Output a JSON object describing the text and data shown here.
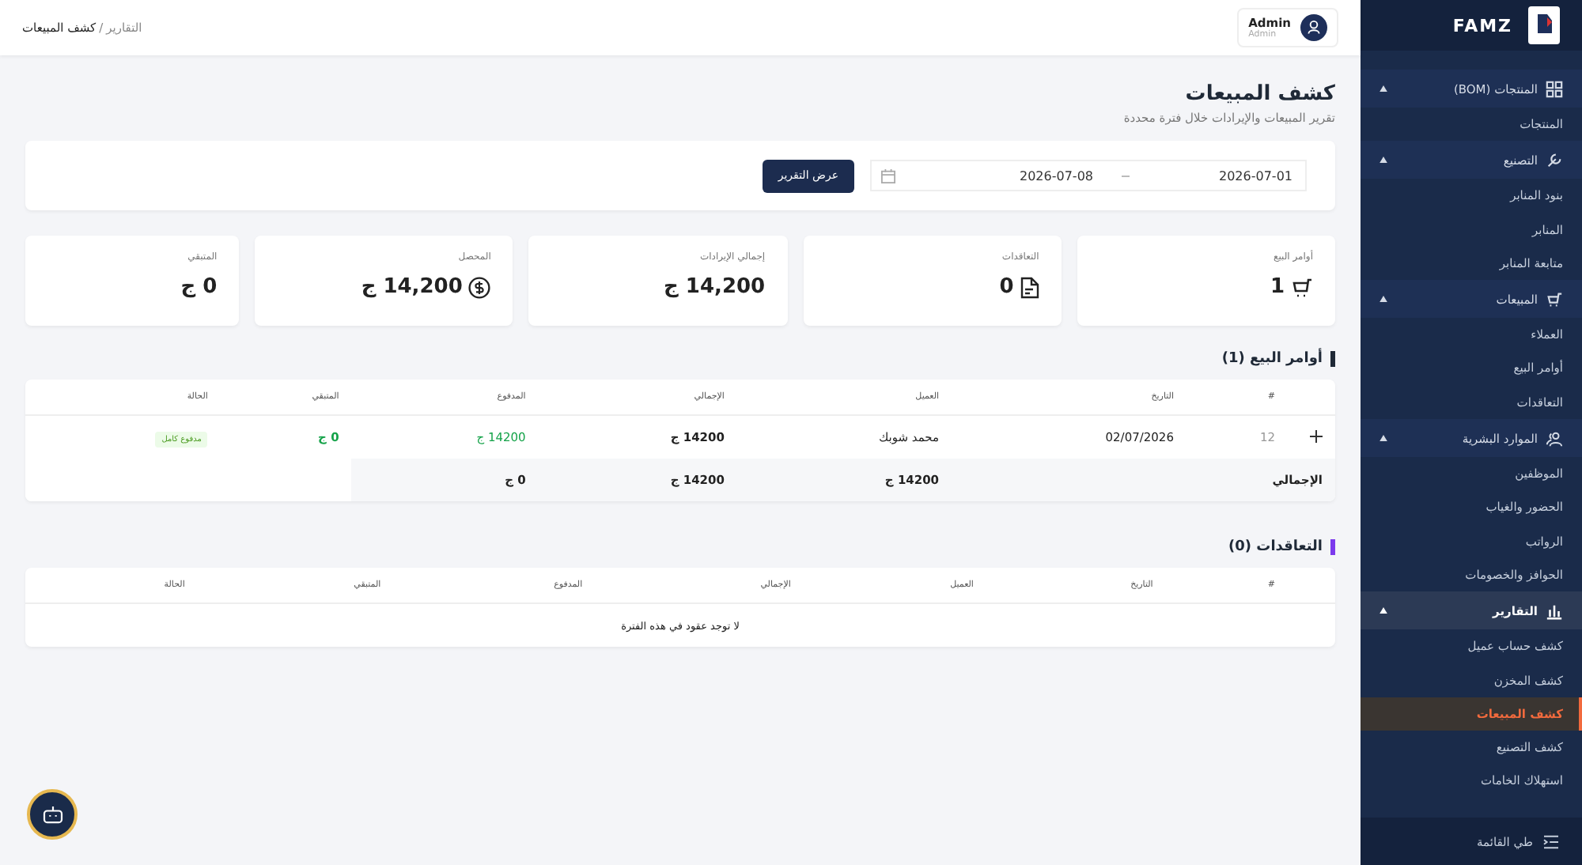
{
  "sidebar": {
    "brand": "FAMZ",
    "groups": [
      {
        "label": "المنتجات (BOM)",
        "expanded": true,
        "selected": false,
        "children": [
          {
            "label": "المنتجات",
            "selected": false
          }
        ]
      },
      {
        "label": "التصنيع",
        "expanded": true,
        "selected": false,
        "children": [
          {
            "label": "بنود المنابر",
            "selected": false
          },
          {
            "label": "المنابر",
            "selected": false
          },
          {
            "label": "متابعة المنابر",
            "selected": false
          }
        ]
      },
      {
        "label": "المبيعات",
        "expanded": true,
        "selected": false,
        "children": [
          {
            "label": "العملاء",
            "selected": false
          },
          {
            "label": "أوامر البيع",
            "selected": false
          },
          {
            "label": "التعاقدات",
            "selected": false
          }
        ]
      },
      {
        "label": "الموارد البشرية",
        "expanded": true,
        "selected": false,
        "children": [
          {
            "label": "الموظفين",
            "selected": false
          },
          {
            "label": "الحضور والغياب",
            "selected": false
          },
          {
            "label": "الرواتب",
            "selected": false
          },
          {
            "label": "الحوافز والخصومات",
            "selected": false
          }
        ]
      },
      {
        "label": "التقارير",
        "expanded": true,
        "selected": true,
        "children": [
          {
            "label": "كشف حساب عميل",
            "selected": false
          },
          {
            "label": "كشف المخزن",
            "selected": false
          },
          {
            "label": "كشف المبيعات",
            "selected": true
          },
          {
            "label": "كشف التصنيع",
            "selected": false
          },
          {
            "label": "استهلاك الخامات",
            "selected": false
          }
        ]
      }
    ],
    "collapse": {
      "label": "طي القائمة"
    }
  },
  "topbar": {
    "breadcrumb": {
      "parent": "التقارير",
      "separator": "/",
      "current": "كشف المبيعات"
    },
    "user": {
      "name": "Admin",
      "role": "Admin"
    }
  },
  "page": {
    "title": "كشف المبيعات",
    "subtitle": "تقرير المبيعات والإيرادات خلال فترة محددة"
  },
  "filter": {
    "from": "2026-07-01",
    "to": "2026-07-08",
    "button": "عرض التقرير"
  },
  "stats": [
    {
      "label": "أوامر البيع",
      "value": "1"
    },
    {
      "label": "التعاقدات",
      "value": "0"
    },
    {
      "label": "إجمالي الإيرادات",
      "value": "14,200 ج"
    },
    {
      "label": "المحصل",
      "value": "14,200 ج"
    },
    {
      "label": "المتبقي",
      "value": "0 ج"
    }
  ],
  "sales_orders": {
    "title": "أوامر البيع (1)",
    "color": "#1f2937",
    "columns": [
      "#",
      "التاريخ",
      "العميل",
      "الإجمالي",
      "المدفوع",
      "المتبقي",
      "الحالة"
    ],
    "rows": [
      {
        "expanded": false,
        "cells": [
          "12",
          "02/07/2026",
          "محمد شوبك",
          "14200 ج",
          "14200 ج",
          "0 ج"
        ],
        "status": {
          "kind": "paid",
          "label": "مدفوع كامل"
        }
      }
    ],
    "totals": {
      "label": "الإجمالي",
      "values": [
        "14200 ج",
        "14200 ج",
        "0 ج"
      ]
    }
  },
  "contracts": {
    "title": "التعاقدات (0)",
    "color": "#7c3aed",
    "columns": [
      "#",
      "التاريخ",
      "العميل",
      "الإجمالي",
      "المدفوع",
      "المتبقي",
      "الحالة"
    ],
    "empty": "لا توجد عقود في هذه الفترة"
  }
}
